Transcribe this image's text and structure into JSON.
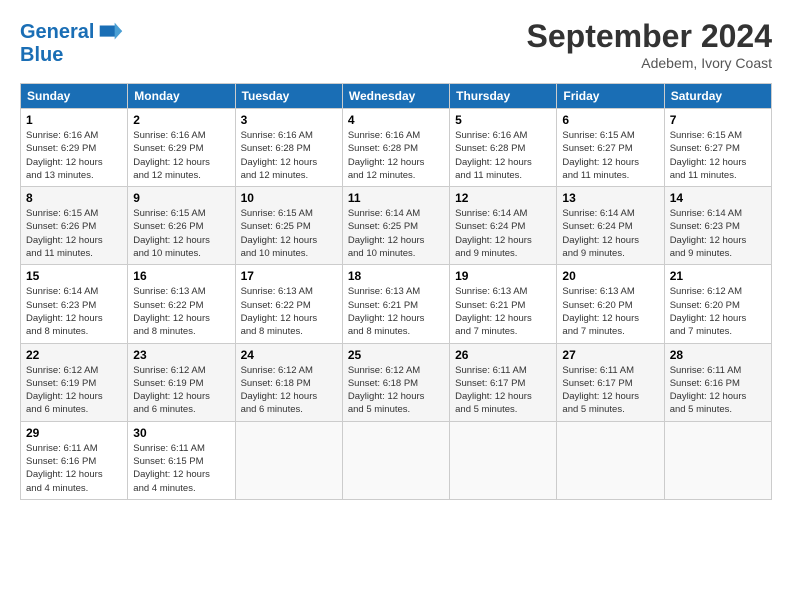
{
  "header": {
    "logo_line1": "General",
    "logo_line2": "Blue",
    "month_title": "September 2024",
    "location": "Adebem, Ivory Coast"
  },
  "days_of_week": [
    "Sunday",
    "Monday",
    "Tuesday",
    "Wednesday",
    "Thursday",
    "Friday",
    "Saturday"
  ],
  "weeks": [
    [
      {
        "day": "1",
        "sunrise": "6:16 AM",
        "sunset": "6:29 PM",
        "daylight": "12 hours and 13 minutes."
      },
      {
        "day": "2",
        "sunrise": "6:16 AM",
        "sunset": "6:29 PM",
        "daylight": "12 hours and 12 minutes."
      },
      {
        "day": "3",
        "sunrise": "6:16 AM",
        "sunset": "6:28 PM",
        "daylight": "12 hours and 12 minutes."
      },
      {
        "day": "4",
        "sunrise": "6:16 AM",
        "sunset": "6:28 PM",
        "daylight": "12 hours and 12 minutes."
      },
      {
        "day": "5",
        "sunrise": "6:16 AM",
        "sunset": "6:28 PM",
        "daylight": "12 hours and 11 minutes."
      },
      {
        "day": "6",
        "sunrise": "6:15 AM",
        "sunset": "6:27 PM",
        "daylight": "12 hours and 11 minutes."
      },
      {
        "day": "7",
        "sunrise": "6:15 AM",
        "sunset": "6:27 PM",
        "daylight": "12 hours and 11 minutes."
      }
    ],
    [
      {
        "day": "8",
        "sunrise": "6:15 AM",
        "sunset": "6:26 PM",
        "daylight": "12 hours and 11 minutes."
      },
      {
        "day": "9",
        "sunrise": "6:15 AM",
        "sunset": "6:26 PM",
        "daylight": "12 hours and 10 minutes."
      },
      {
        "day": "10",
        "sunrise": "6:15 AM",
        "sunset": "6:25 PM",
        "daylight": "12 hours and 10 minutes."
      },
      {
        "day": "11",
        "sunrise": "6:14 AM",
        "sunset": "6:25 PM",
        "daylight": "12 hours and 10 minutes."
      },
      {
        "day": "12",
        "sunrise": "6:14 AM",
        "sunset": "6:24 PM",
        "daylight": "12 hours and 9 minutes."
      },
      {
        "day": "13",
        "sunrise": "6:14 AM",
        "sunset": "6:24 PM",
        "daylight": "12 hours and 9 minutes."
      },
      {
        "day": "14",
        "sunrise": "6:14 AM",
        "sunset": "6:23 PM",
        "daylight": "12 hours and 9 minutes."
      }
    ],
    [
      {
        "day": "15",
        "sunrise": "6:14 AM",
        "sunset": "6:23 PM",
        "daylight": "12 hours and 8 minutes."
      },
      {
        "day": "16",
        "sunrise": "6:13 AM",
        "sunset": "6:22 PM",
        "daylight": "12 hours and 8 minutes."
      },
      {
        "day": "17",
        "sunrise": "6:13 AM",
        "sunset": "6:22 PM",
        "daylight": "12 hours and 8 minutes."
      },
      {
        "day": "18",
        "sunrise": "6:13 AM",
        "sunset": "6:21 PM",
        "daylight": "12 hours and 8 minutes."
      },
      {
        "day": "19",
        "sunrise": "6:13 AM",
        "sunset": "6:21 PM",
        "daylight": "12 hours and 7 minutes."
      },
      {
        "day": "20",
        "sunrise": "6:13 AM",
        "sunset": "6:20 PM",
        "daylight": "12 hours and 7 minutes."
      },
      {
        "day": "21",
        "sunrise": "6:12 AM",
        "sunset": "6:20 PM",
        "daylight": "12 hours and 7 minutes."
      }
    ],
    [
      {
        "day": "22",
        "sunrise": "6:12 AM",
        "sunset": "6:19 PM",
        "daylight": "12 hours and 6 minutes."
      },
      {
        "day": "23",
        "sunrise": "6:12 AM",
        "sunset": "6:19 PM",
        "daylight": "12 hours and 6 minutes."
      },
      {
        "day": "24",
        "sunrise": "6:12 AM",
        "sunset": "6:18 PM",
        "daylight": "12 hours and 6 minutes."
      },
      {
        "day": "25",
        "sunrise": "6:12 AM",
        "sunset": "6:18 PM",
        "daylight": "12 hours and 5 minutes."
      },
      {
        "day": "26",
        "sunrise": "6:11 AM",
        "sunset": "6:17 PM",
        "daylight": "12 hours and 5 minutes."
      },
      {
        "day": "27",
        "sunrise": "6:11 AM",
        "sunset": "6:17 PM",
        "daylight": "12 hours and 5 minutes."
      },
      {
        "day": "28",
        "sunrise": "6:11 AM",
        "sunset": "6:16 PM",
        "daylight": "12 hours and 5 minutes."
      }
    ],
    [
      {
        "day": "29",
        "sunrise": "6:11 AM",
        "sunset": "6:16 PM",
        "daylight": "12 hours and 4 minutes."
      },
      {
        "day": "30",
        "sunrise": "6:11 AM",
        "sunset": "6:15 PM",
        "daylight": "12 hours and 4 minutes."
      },
      null,
      null,
      null,
      null,
      null
    ]
  ]
}
